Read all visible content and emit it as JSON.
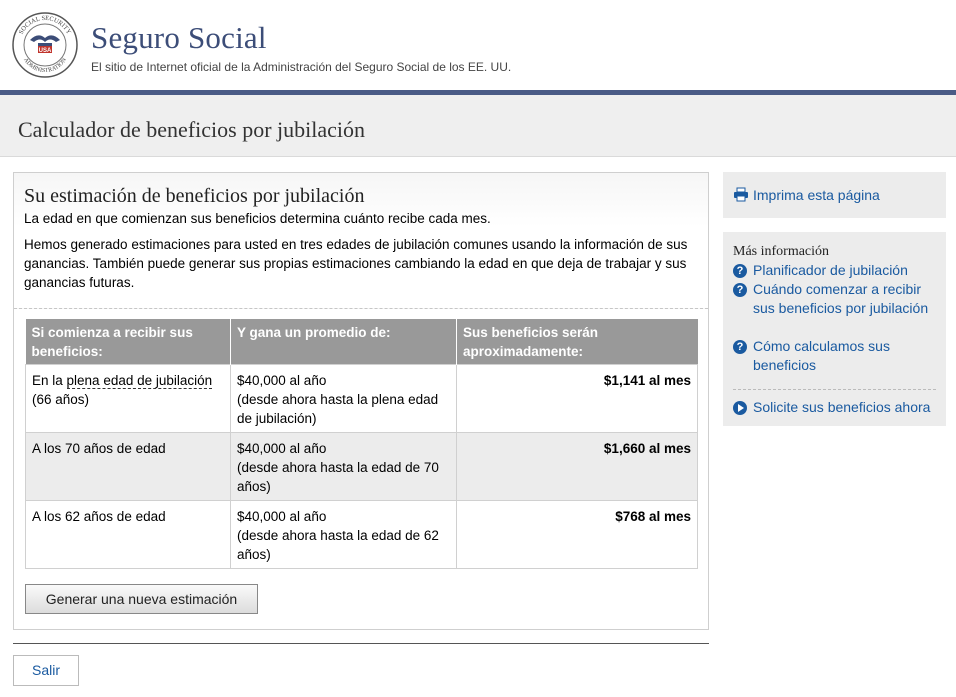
{
  "header": {
    "seal_text_top": "SOCIAL SECURITY",
    "seal_text_bottom": "ADMINISTRATION",
    "seal_badge": "USA",
    "site_title": "Seguro Social",
    "site_subtitle": "El sitio de Internet oficial de la Administración del Seguro Social de los EE. UU."
  },
  "page_title": "Calculador de beneficios por jubilación",
  "estimate": {
    "title": "Su estimación de beneficios por jubilación",
    "subtitle": "La edad en que comienzan sus beneficios determina cuánto recibe cada mes.",
    "paragraph": "Hemos generado estimaciones para usted en tres edades de jubilación comunes usando la información de sus ganancias. También puede generar sus propias estimaciones cambiando la edad en que deja de trabajar y sus ganancias futuras."
  },
  "table": {
    "headers": [
      "Si comienza a recibir sus beneficios:",
      "Y gana un promedio de:",
      "Sus beneficios serán aproximadamente:"
    ],
    "rows": [
      {
        "age_prefix": "En la ",
        "age_link": "plena edad de jubilación",
        "age_suffix": "(66 años)",
        "earnings_line1": "$40,000 al año",
        "earnings_line2": "(desde ahora hasta la plena edad de jubilación)",
        "benefit": "$1,141 al mes"
      },
      {
        "age": "A los 70 años de edad",
        "earnings_line1": "$40,000 al año",
        "earnings_line2": "(desde ahora hasta la edad de 70 años)",
        "benefit": "$1,660 al mes"
      },
      {
        "age": "A los 62 años de edad",
        "earnings_line1": "$40,000 al año",
        "earnings_line2": "(desde ahora hasta la edad de 62 años)",
        "benefit": "$768 al mes"
      }
    ]
  },
  "buttons": {
    "generate": "Generar una nueva estimación",
    "exit": "Salir"
  },
  "sidebar": {
    "print": "Imprima esta página",
    "more_title": "Más información",
    "links": [
      "Planificador de jubilación",
      "Cuándo comenzar a recibir sus beneficios por jubilación",
      "Cómo calculamos sus beneficios"
    ],
    "apply": "Solicite sus beneficios ahora"
  },
  "colors": {
    "brand_blue": "#3c4d78",
    "link_blue": "#1a5aa0",
    "header_row_gray": "#999999"
  },
  "icons": {
    "print": "printer-icon",
    "help": "question-circle-icon",
    "apply": "play-circle-icon",
    "seal": "ssa-seal-icon"
  }
}
